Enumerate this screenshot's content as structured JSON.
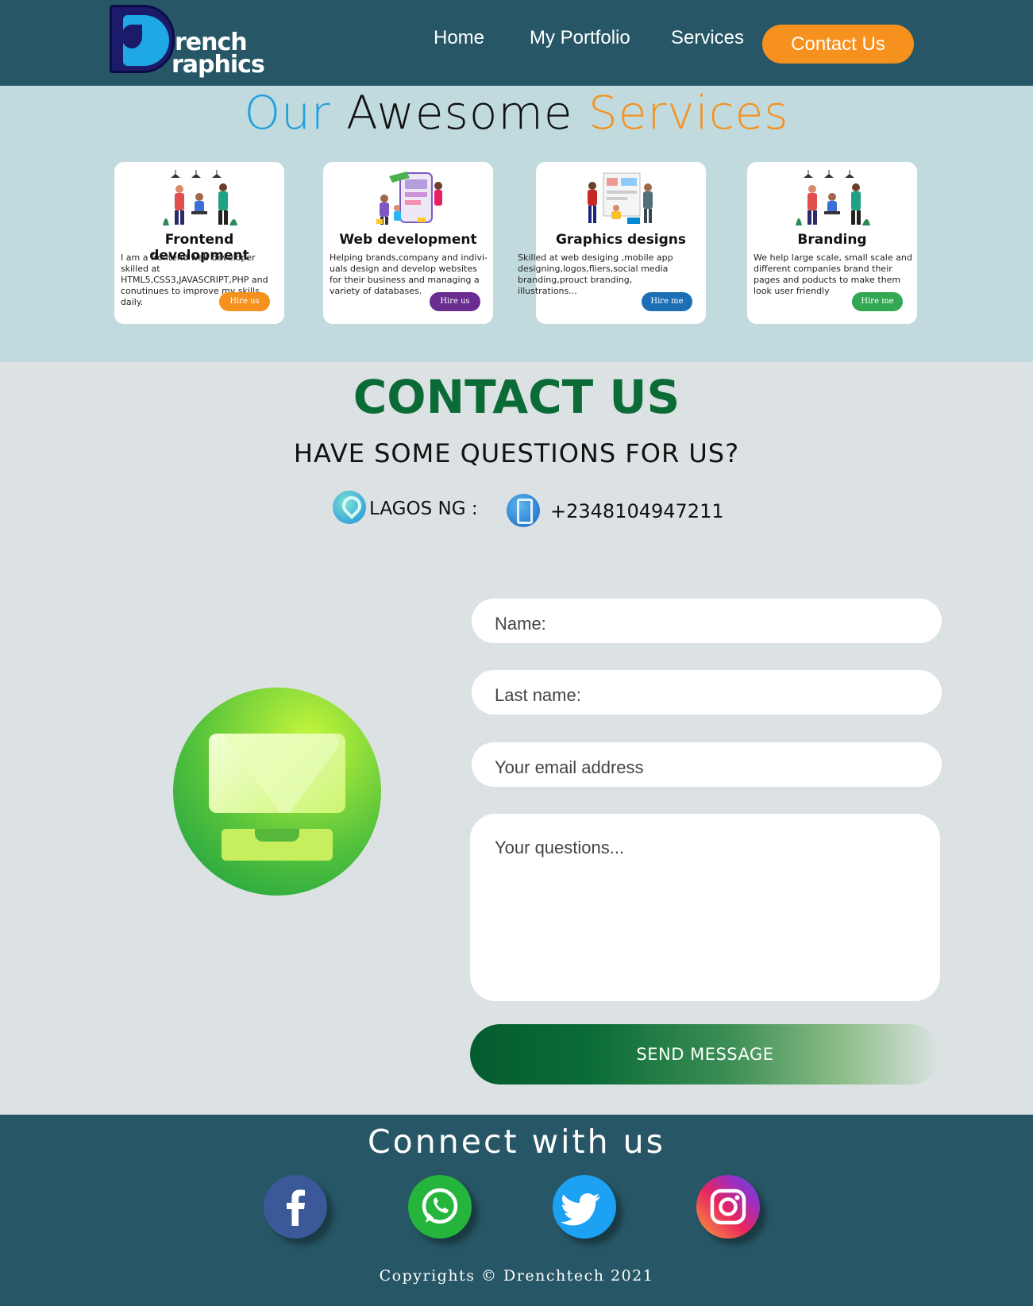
{
  "header": {
    "logo_line1": "rench",
    "logo_line2": "raphics",
    "nav": [
      "Home",
      "My Portfolio",
      "Services"
    ],
    "contact_button": "Contact Us",
    "colors": {
      "bar": "#275766",
      "accent": "#f6911e"
    }
  },
  "services": {
    "title_part1": "Our",
    "title_part2": "Awesome",
    "title_part3": "Services",
    "cards": [
      {
        "title": "Frontend development",
        "description": "I am a frontend web developer skilled at HTML5,CSS3,JAVASCRIPT,PHP and conutinues to improve my skills daily.",
        "button": "Hire us",
        "button_color": "#f6911e",
        "illustration_icon": "team-illustration-icon"
      },
      {
        "title": "Web development",
        "description": "Helping brands,company and indivi-uals design and develop websites for their business and managing a variety of databases.",
        "button": "Hire us",
        "button_color": "#6a2c8f",
        "illustration_icon": "web-dev-illustration-icon"
      },
      {
        "title": "Graphics designs",
        "description": "Skilled at web desiging ,mobile app designing,logos,fliers,social media branding,prouct branding, illustrations...",
        "button": "Hire me",
        "button_color": "#1c6fb5",
        "illustration_icon": "design-team-illustration-icon"
      },
      {
        "title": "Branding",
        "description": "We help large scale, small scale and different companies brand their pages and poducts to make them look user friendly",
        "button": "Hire me",
        "button_color": "#33a852",
        "illustration_icon": "team-illustration-icon"
      }
    ]
  },
  "contact": {
    "title": "CONTACT US",
    "subtitle": "HAVE SOME QUESTIONS FOR US?",
    "location": "LAGOS  NG :",
    "phone": "+2348104947211",
    "form": {
      "name_placeholder": "Name:",
      "lastname_placeholder": "Last name:",
      "email_placeholder": "Your email address",
      "questions_placeholder": "Your questions...",
      "send_button": "SEND MESSAGE"
    }
  },
  "footer": {
    "heading": "Connect with us",
    "social": [
      "facebook-icon",
      "whatsapp-icon",
      "twitter-icon",
      "instagram-icon"
    ],
    "copyright": "Copyrights © Drenchtech 2021"
  }
}
